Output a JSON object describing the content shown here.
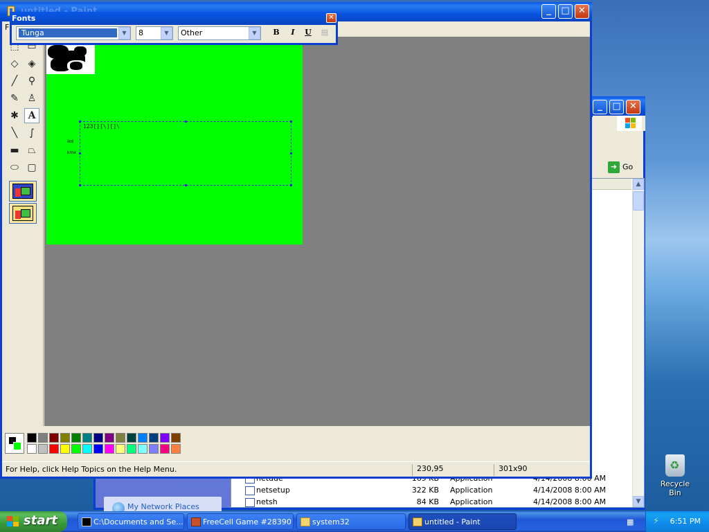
{
  "paint": {
    "title": "untitled - Paint",
    "menu_first": "F",
    "canvas_text": "123[][\\][]\\",
    "side_labels": [
      "ikd",
      "kme"
    ],
    "status": {
      "help": "For Help, click Help Topics on the Help Menu.",
      "coords": "230,95",
      "size": "301x90"
    },
    "current_fg": "#000000",
    "current_bg": "#00ff00",
    "palette_top": [
      "#000000",
      "#808080",
      "#800000",
      "#808000",
      "#008000",
      "#008080",
      "#000080",
      "#800080",
      "#808040",
      "#004040",
      "#0080ff",
      "#004080",
      "#8000ff",
      "#804000"
    ],
    "palette_bottom": [
      "#ffffff",
      "#c0c0c0",
      "#ff0000",
      "#ffff00",
      "#00ff00",
      "#00ffff",
      "#0000ff",
      "#ff00ff",
      "#ffff80",
      "#00ff80",
      "#80ffff",
      "#8080ff",
      "#ff0080",
      "#ff8040"
    ]
  },
  "fonts": {
    "title": "Fonts",
    "font_name": "Tunga",
    "font_size": "8",
    "script": "Other",
    "bold": "B",
    "italic": "I",
    "underline": "U"
  },
  "explorer": {
    "go_label": "Go",
    "network_places": "My Network Places",
    "files": [
      {
        "name": "netdde",
        "size": "169 KB",
        "type": "Application",
        "date": "4/14/2008 8:00 AM"
      },
      {
        "name": "netsetup",
        "size": "322 KB",
        "type": "Application",
        "date": "4/14/2008 8:00 AM"
      },
      {
        "name": "netsh",
        "size": "84 KB",
        "type": "Application",
        "date": "4/14/2008 8:00 AM"
      }
    ]
  },
  "desktop": {
    "recycle_bin": "Recycle Bin"
  },
  "taskbar": {
    "start": "start",
    "tasks": [
      {
        "label": "C:\\Documents and Se..."
      },
      {
        "label": "FreeCell Game #28390"
      },
      {
        "label": "system32"
      },
      {
        "label": "untitled - Paint"
      }
    ],
    "clock": "6:51 PM"
  }
}
